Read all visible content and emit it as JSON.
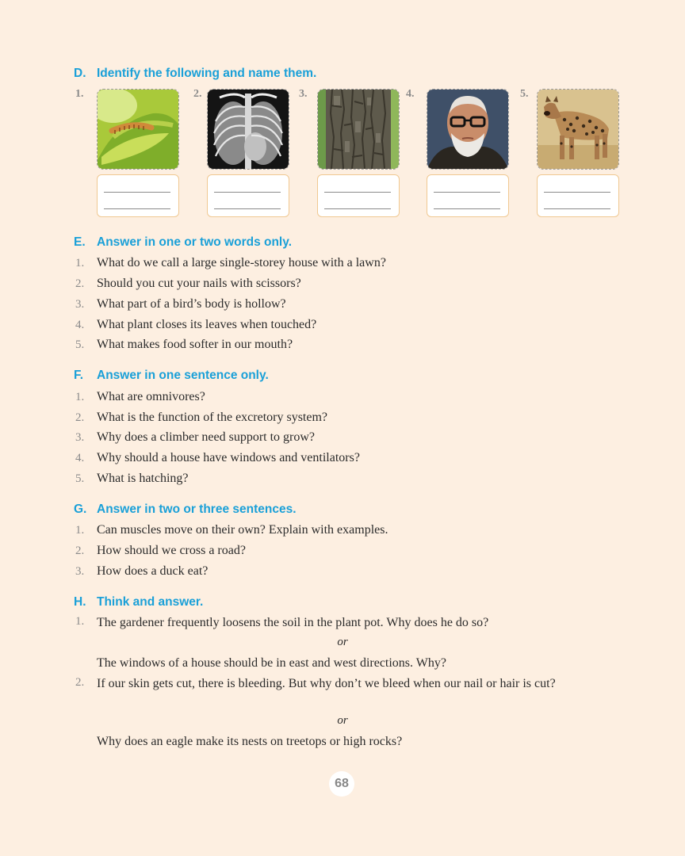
{
  "sections": {
    "d": {
      "letter": "D.",
      "title": "Identify the following and name them."
    },
    "e": {
      "letter": "E.",
      "title": "Answer in one or two words only."
    },
    "f": {
      "letter": "F.",
      "title": "Answer in one sentence only."
    },
    "g": {
      "letter": "G.",
      "title": "Answer in two or three sentences."
    },
    "h": {
      "letter": "H.",
      "title": "Think and answer."
    }
  },
  "identify_items": [
    {
      "num": "1.",
      "icon": "venus-flytrap-photo"
    },
    {
      "num": "2.",
      "icon": "chest-xray-photo"
    },
    {
      "num": "3.",
      "icon": "tree-bark-photo"
    },
    {
      "num": "4.",
      "icon": "old-man-photo"
    },
    {
      "num": "5.",
      "icon": "hyena-photo"
    }
  ],
  "e_questions": [
    {
      "num": "1.",
      "text": "What do we call a large single-storey house with a lawn?"
    },
    {
      "num": "2.",
      "text": "Should you cut your nails with scissors?"
    },
    {
      "num": "3.",
      "text": "What part of a bird’s body is hollow?"
    },
    {
      "num": "4.",
      "text": "What plant closes its leaves when touched?"
    },
    {
      "num": "5.",
      "text": "What makes food softer in our mouth?"
    }
  ],
  "f_questions": [
    {
      "num": "1.",
      "text": "What are omnivores?"
    },
    {
      "num": "2.",
      "text": "What is the function of the excretory system?"
    },
    {
      "num": "3.",
      "text": "Why does a climber need support to grow?"
    },
    {
      "num": "4.",
      "text": "Why should a house have windows and ventilators?"
    },
    {
      "num": "5.",
      "text": "What is hatching?"
    }
  ],
  "g_questions": [
    {
      "num": "1.",
      "text": "Can muscles move on their own? Explain with examples."
    },
    {
      "num": "2.",
      "text": "How should we cross a road?"
    },
    {
      "num": "3.",
      "text": "How does a duck eat?"
    }
  ],
  "h_questions": [
    {
      "num": "1.",
      "text": "The gardener frequently loosens the soil in the plant pot. Why does he do so?",
      "or": "or",
      "alt": "The windows of a house should be in east and west directions. Why?"
    },
    {
      "num": "2.",
      "text": "If our skin gets cut, there is bleeding. But why don’t we bleed when our nail or hair is cut?",
      "or": "or",
      "alt": "Why does an eagle make its nests on treetops or high rocks?"
    }
  ],
  "page_number": "68",
  "colors": {
    "heading": "#1aa0d8",
    "background": "#fdefe1",
    "answer_border": "#f0c891"
  }
}
